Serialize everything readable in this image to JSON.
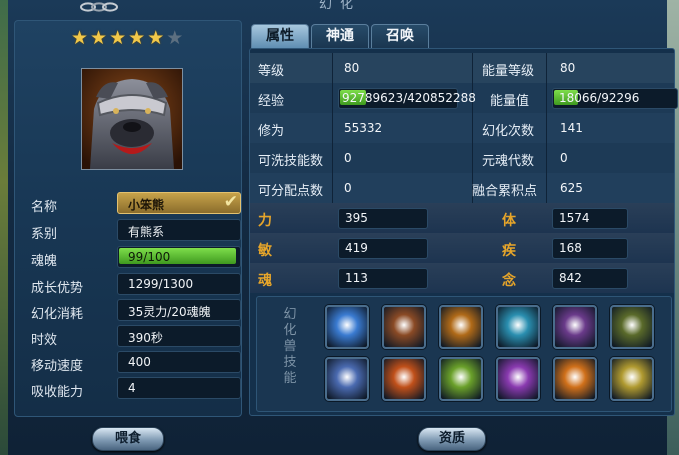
{
  "window": {
    "title": "幻化"
  },
  "stars": {
    "filled": 5,
    "total": 6
  },
  "pet": {
    "name_label": "名称",
    "name": "小笨熊",
    "type_label": "系别",
    "type": "有熊系",
    "soul_label": "魂魄",
    "soul": "99/100",
    "soul_fraction": 0.99,
    "growth_label": "成长优势",
    "growth": "1299/1300",
    "cost_label": "幻化消耗",
    "cost": "35灵力/20魂魄",
    "duration_label": "时效",
    "duration": "390秒",
    "speed_label": "移动速度",
    "speed": "400",
    "absorb_label": "吸收能力",
    "absorb": "4"
  },
  "buttons": {
    "feed": "喂食",
    "aptitude": "资质"
  },
  "tabs": [
    "属性",
    "神通",
    "召唤"
  ],
  "stats": {
    "level_label": "等级",
    "level": "80",
    "energy_level_label": "能量等级",
    "energy_level": "80",
    "exp_label": "经验",
    "exp": "92789623/420852288",
    "exp_fraction": 0.22,
    "energy_label": "能量值",
    "energy": "18066/92296",
    "energy_fraction": 0.2,
    "cultivation_label": "修为",
    "cultivation": "55332",
    "transform_count_label": "幻化次数",
    "transform_count": "141",
    "wash_label": "可洗技能数",
    "wash": "0",
    "generation_label": "元魂代数",
    "generation": "0",
    "alloc_label": "可分配点数",
    "alloc": "0",
    "fusion_label": "融合累积点",
    "fusion": "625"
  },
  "attributes": {
    "str_label": "力",
    "str": "395",
    "con_label": "体",
    "con": "1574",
    "agi_label": "敏",
    "agi": "419",
    "spd_label": "疾",
    "spd": "168",
    "spi_label": "魂",
    "spi": "113",
    "mind_label": "念",
    "mind": "842"
  },
  "skills": {
    "label": "幻化兽技能",
    "icons": [
      {
        "name": "blue-orb-skill-icon",
        "color": "#3a7bd1"
      },
      {
        "name": "claw-strike-skill-icon",
        "color": "#8a4a25"
      },
      {
        "name": "golden-slash-skill-icon",
        "color": "#b06a18"
      },
      {
        "name": "cyan-figure-skill-icon",
        "color": "#2a8fb0"
      },
      {
        "name": "purple-boot-skill-icon",
        "color": "#6a3a8a"
      },
      {
        "name": "green-beast-skill-icon",
        "color": "#5a6a2a"
      },
      {
        "name": "silver-shield-skill-icon",
        "color": "#4a6ab0"
      },
      {
        "name": "fire-burst-skill-icon",
        "color": "#c0501a"
      },
      {
        "name": "green-shield-skill-icon",
        "color": "#6aa02a"
      },
      {
        "name": "purple-vortex-skill-icon",
        "color": "#8a3ab0"
      },
      {
        "name": "orange-shield-skill-icon",
        "color": "#d0701a"
      },
      {
        "name": "golden-lightning-skill-icon",
        "color": "#b09a30"
      }
    ]
  },
  "colors": {
    "gold_label": "#e6a52a",
    "progress": "#5ec232",
    "name_box": "#b8923e"
  }
}
